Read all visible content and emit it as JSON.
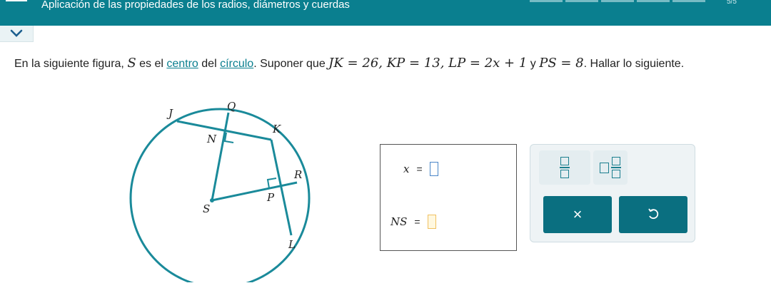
{
  "header": {
    "title": "Aplicación de las propiedades de los radios, diámetros y cuerdas",
    "progress_count": "5/5",
    "progress_segments": 5
  },
  "statement": {
    "part1": "En la siguiente figura, ",
    "center_var": "S",
    "part2": " es el ",
    "link_centro": "centro",
    "part3": " del ",
    "link_circulo": "círculo",
    "part4": ". Suponer que ",
    "given": "JK = 26, KP = 13, LP = 2x + 1",
    "conj": " y ",
    "given2": "PS = 8",
    "part5": ". Hallar lo siguiente."
  },
  "figure": {
    "labels": {
      "J": "J",
      "Q": "Q",
      "N": "N",
      "K": "K",
      "R": "R",
      "P": "P",
      "S": "S",
      "L": "L"
    },
    "stroke_color": "#1a8a9a"
  },
  "answers": {
    "x_label": "x",
    "ns_label": "NS",
    "equals": "="
  },
  "palette": {
    "times_symbol": "×",
    "undo_symbol": "↺"
  },
  "colors": {
    "header_bg": "#0a7f8f",
    "accent": "#0a7f8f",
    "button_dark": "#0a6f80"
  }
}
